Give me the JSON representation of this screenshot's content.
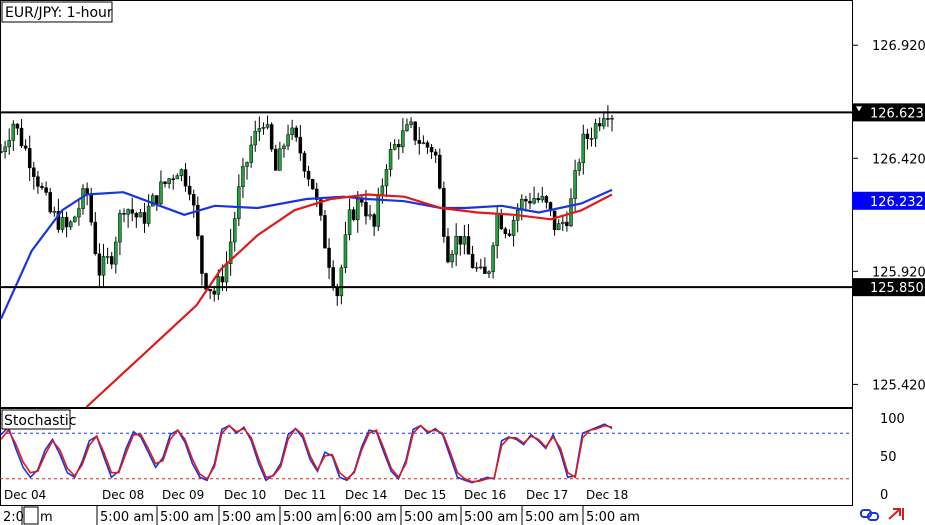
{
  "chart_data": [
    {
      "type": "candlestick",
      "title": "EUR/JPY: 1-hour",
      "ylim": [
        125.32,
        127.12
      ],
      "y_ticks": [
        "126.920",
        "126.420",
        "125.920",
        "125.420"
      ],
      "date_labels": [
        "Dec 04",
        "Dec 08",
        "Dec 09",
        "Dec 10",
        "Dec 11",
        "Dec 14",
        "Dec 15",
        "Dec 16",
        "Dec 17",
        "Dec 18"
      ],
      "time_labels": [
        "2:0",
        "m",
        "5:00 am",
        "5:00 am",
        "5:00 am",
        "5:00 am",
        "6:00 am",
        "5:00 am",
        "5:00 am",
        "5:00 am",
        "5:00 am"
      ],
      "horizontal_lines": [
        {
          "value": 126.623,
          "label": "126.623",
          "color": "#000000"
        },
        {
          "value": 125.85,
          "label": "125.850",
          "color": "#000000"
        }
      ],
      "price_tags": [
        {
          "value": 126.623,
          "label": "126.623",
          "bg": "#000000"
        },
        {
          "value": 126.232,
          "label": "126.232",
          "bg": "#0000ff"
        },
        {
          "value": 125.85,
          "label": "125.850",
          "bg": "#000000"
        }
      ],
      "moving_averages": [
        {
          "color": "#1a35e0",
          "points": [
            [
              0,
              125.71
            ],
            [
              0.05,
              126.01
            ],
            [
              0.1,
              126.19
            ],
            [
              0.14,
              126.26
            ],
            [
              0.2,
              126.27
            ],
            [
              0.26,
              126.21
            ],
            [
              0.3,
              126.17
            ],
            [
              0.35,
              126.21
            ],
            [
              0.42,
              126.2
            ],
            [
              0.5,
              126.24
            ],
            [
              0.56,
              126.25
            ],
            [
              0.6,
              126.24
            ],
            [
              0.66,
              126.23
            ],
            [
              0.72,
              126.2
            ],
            [
              0.76,
              126.2
            ],
            [
              0.82,
              126.21
            ],
            [
              0.88,
              126.18
            ],
            [
              0.95,
              126.22
            ],
            [
              1,
              126.28
            ]
          ]
        },
        {
          "color": "#e01a1a",
          "points": [
            [
              0.14,
              125.32
            ],
            [
              0.2,
              125.47
            ],
            [
              0.26,
              125.62
            ],
            [
              0.32,
              125.77
            ],
            [
              0.36,
              125.93
            ],
            [
              0.42,
              126.08
            ],
            [
              0.48,
              126.19
            ],
            [
              0.54,
              126.24
            ],
            [
              0.6,
              126.26
            ],
            [
              0.66,
              126.25
            ],
            [
              0.72,
              126.2
            ],
            [
              0.78,
              126.18
            ],
            [
              0.84,
              126.17
            ],
            [
              0.9,
              126.15
            ],
            [
              0.95,
              126.19
            ],
            [
              1,
              126.26
            ]
          ]
        }
      ]
    },
    {
      "type": "line",
      "title": "Stochastic",
      "ylim": [
        0,
        100
      ],
      "y_ticks": [
        "100",
        "50",
        "0"
      ],
      "levels": [
        80,
        20
      ],
      "series": [
        {
          "color": "#1a35e0",
          "values": [
            78,
            88,
            60,
            35,
            22,
            32,
            58,
            72,
            52,
            28,
            22,
            42,
            70,
            76,
            48,
            22,
            30,
            60,
            82,
            75,
            55,
            35,
            48,
            78,
            84,
            68,
            40,
            22,
            18,
            40,
            85,
            90,
            80,
            88,
            70,
            40,
            18,
            25,
            40,
            78,
            86,
            74,
            45,
            30,
            55,
            50,
            22,
            18,
            30,
            62,
            84,
            82,
            55,
            30,
            20,
            44,
            85,
            90,
            80,
            86,
            78,
            50,
            22,
            18,
            15,
            18,
            22,
            20,
            70,
            75,
            72,
            65,
            78,
            70,
            60,
            78,
            55,
            22,
            24,
            80,
            84,
            88,
            92,
            86
          ]
        },
        {
          "color": "#e01a1a",
          "values": [
            72,
            84,
            66,
            42,
            28,
            30,
            52,
            70,
            58,
            34,
            24,
            38,
            64,
            76,
            54,
            28,
            28,
            54,
            78,
            78,
            60,
            40,
            44,
            72,
            84,
            72,
            46,
            26,
            20,
            36,
            80,
            90,
            82,
            86,
            74,
            46,
            22,
            24,
            36,
            72,
            86,
            78,
            50,
            32,
            50,
            52,
            28,
            20,
            28,
            58,
            80,
            84,
            60,
            34,
            22,
            40,
            80,
            90,
            82,
            84,
            80,
            56,
            28,
            20,
            16,
            17,
            20,
            21,
            64,
            74,
            74,
            67,
            76,
            72,
            62,
            75,
            60,
            28,
            22,
            74,
            84,
            86,
            90,
            88
          ]
        }
      ]
    }
  ]
}
